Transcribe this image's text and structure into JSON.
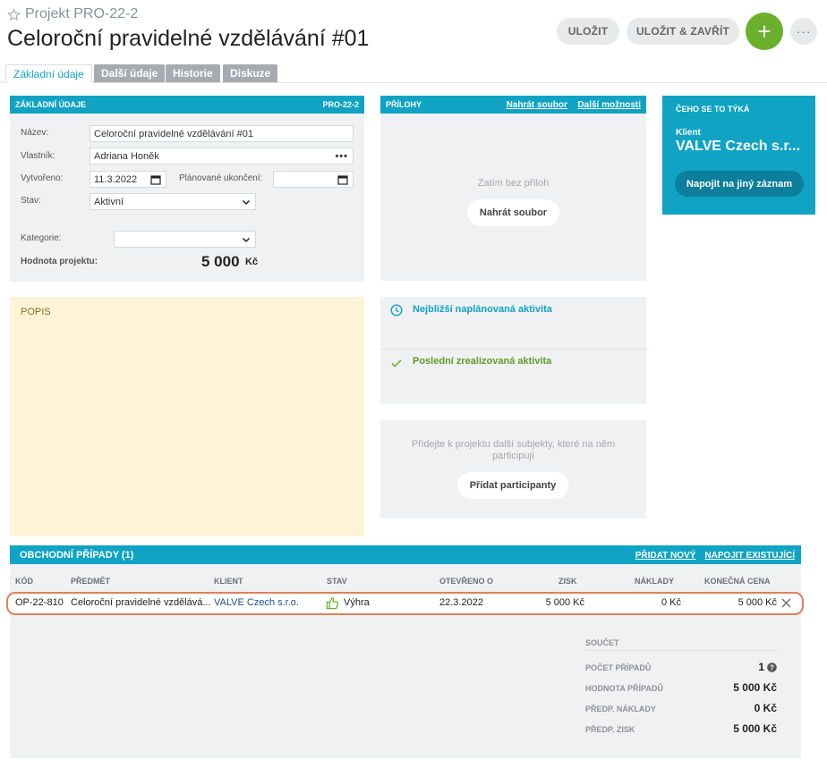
{
  "header": {
    "subtitle": "Projekt PRO-22-2",
    "title": "Celoroční pravidelné vzdělávání #01",
    "save_label": "ULOŽIT",
    "save_close_label": "ULOŽIT & ZAVŘÍT",
    "add_label": "+",
    "more_label": "···"
  },
  "tabs": [
    {
      "label": "Základní údaje"
    },
    {
      "label": "Další údaje"
    },
    {
      "label": "Historie"
    },
    {
      "label": "Diskuze"
    }
  ],
  "basic": {
    "heading": "ZÁKLADNÍ ÚDAJE",
    "code": "PRO-22-2",
    "name_label": "Název:",
    "name_value": "Celoroční pravidelné vzdělávání #01",
    "owner_label": "Vlastník:",
    "owner_value": "Adriana Honěk",
    "created_label": "Vytvořeno:",
    "created_value": "11.3.2022",
    "planned_label": "Plánované ukončení:",
    "planned_value": "",
    "state_label": "Stav:",
    "state_value": "Aktivní",
    "category_label": "Kategorie:",
    "category_value": "",
    "value_label": "Hodnota projektu:",
    "value_amount": "5 000",
    "value_currency": "Kč"
  },
  "attachments": {
    "heading": "PŘÍLOHY",
    "upload_link": "Nahrát soubor",
    "more_link": "Další možnosti",
    "empty_text": "Zatím bez příloh",
    "upload_button": "Nahrát soubor"
  },
  "related": {
    "heading": "ČEHO SE TO TÝKÁ",
    "client_label": "Klient",
    "client_value": "VALVE Czech s.r...",
    "link_button": "Napojit na jiný záznam"
  },
  "description": {
    "heading": "POPIS"
  },
  "activities": {
    "next_label": "Nejbližší naplánovaná aktivita",
    "last_label": "Poslední zrealizovaná aktivita"
  },
  "participants": {
    "text": "Přidejte k projektu další subjekty, které na něm participují",
    "button": "Přidat participanty"
  },
  "deals": {
    "heading": "OBCHODNÍ PŘÍPADY (1)",
    "add_new": "PŘIDAT NOVÝ",
    "link_existing": "NAPOJIT EXISTUJÍCÍ",
    "columns": {
      "code": "KÓD",
      "subject": "PŘEDMĚT",
      "client": "KLIENT",
      "state": "STAV",
      "opened": "OTEVŘENO O",
      "profit": "ZISK",
      "costs": "NÁKLADY",
      "final": "KONEČNÁ CENA"
    },
    "rows": [
      {
        "code": "OP-22-810",
        "subject": "Celoroční pravidelné vzdělává...",
        "client": "VALVE Czech s.r.o.",
        "state": "Výhra",
        "opened": "22.3.2022",
        "profit": "5 000 Kč",
        "costs": "0 Kč",
        "final": "5 000 Kč"
      }
    ],
    "summary": {
      "heading": "SOUČET",
      "count_label": "POČET PŘÍPADŮ",
      "count_value": "1",
      "value_label": "HODNOTA PŘÍPADŮ",
      "value_value": "5 000 Kč",
      "costs_label": "PŘEDP. NÁKLADY",
      "costs_value": "0 Kč",
      "profit_label": "PŘEDP. ZISK",
      "profit_value": "5 000 Kč"
    }
  },
  "colors": {
    "accent": "#10a3c4",
    "add_button": "#6ab02c",
    "description_bg": "#fdf4d8",
    "highlight_border": "#e0805a",
    "win_icon": "#6ab02c"
  }
}
